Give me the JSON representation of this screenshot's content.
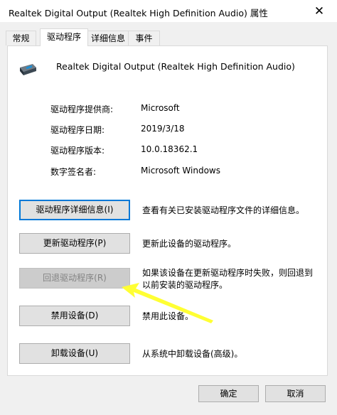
{
  "window": {
    "title": "Realtek Digital Output (Realtek High Definition Audio) 属性",
    "close_glyph": "✕"
  },
  "tabs": [
    {
      "label": "常规",
      "active": false
    },
    {
      "label": "驱动程序",
      "active": true
    },
    {
      "label": "详细信息",
      "active": false
    },
    {
      "label": "事件",
      "active": false
    }
  ],
  "device": {
    "name": "Realtek Digital Output (Realtek High Definition Audio)",
    "icon": "speaker-device-icon"
  },
  "properties": [
    {
      "label": "驱动程序提供商:",
      "value": "Microsoft"
    },
    {
      "label": "驱动程序日期:",
      "value": "2019/3/18"
    },
    {
      "label": "驱动程序版本:",
      "value": "10.0.18362.1"
    },
    {
      "label": "数字签名者:",
      "value": "Microsoft Windows"
    }
  ],
  "actions": [
    {
      "button": "驱动程序详细信息(I)",
      "description": "查看有关已安装驱动程序文件的详细信息。",
      "state": "focused"
    },
    {
      "button": "更新驱动程序(P)",
      "description": "更新此设备的驱动程序。",
      "state": "normal"
    },
    {
      "button": "回退驱动程序(R)",
      "description": "如果该设备在更新驱动程序时失败，则回退到以前安装的驱动程序。",
      "state": "disabled"
    },
    {
      "button": "禁用设备(D)",
      "description": "禁用此设备。",
      "state": "normal"
    },
    {
      "button": "卸载设备(U)",
      "description": "从系统中卸载设备(高级)。",
      "state": "normal"
    }
  ],
  "footer": {
    "ok_label": "确定",
    "cancel_label": "取消"
  },
  "colors": {
    "annotation_arrow": "#ffff33",
    "focus_border": "#0078d7"
  }
}
